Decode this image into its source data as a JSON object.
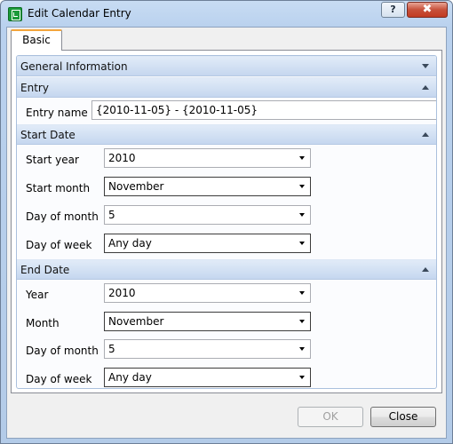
{
  "window": {
    "title": "Edit Calendar Entry",
    "help_label": "?",
    "close_label": "✖"
  },
  "tabs": [
    {
      "label": "Basic",
      "selected": true
    }
  ],
  "sections": {
    "general": {
      "label": "General Information",
      "state": "collapsed"
    },
    "entry": {
      "label": "Entry",
      "state": "expanded",
      "entry_name_label": "Entry name",
      "entry_name_value": "{2010-11-05} - {2010-11-05}"
    },
    "start_date": {
      "label": "Start Date",
      "state": "expanded",
      "fields": [
        {
          "label": "Start year",
          "value": "2010"
        },
        {
          "label": "Start month",
          "value": "November"
        },
        {
          "label": "Day of month",
          "value": "5"
        },
        {
          "label": "Day of week",
          "value": "Any day"
        }
      ]
    },
    "end_date": {
      "label": "End Date",
      "state": "expanded",
      "fields": [
        {
          "label": "Year",
          "value": "2010"
        },
        {
          "label": "Month",
          "value": "November"
        },
        {
          "label": "Day of month",
          "value": "5"
        },
        {
          "label": "Day of week",
          "value": "Any day"
        }
      ]
    }
  },
  "buttons": {
    "ok_label": "OK",
    "ok_enabled": false,
    "close_label": "Close"
  },
  "colors": {
    "tab_accent": "#f3a53c",
    "section_header": "#c5d7ef",
    "title_close": "#c23b22"
  }
}
